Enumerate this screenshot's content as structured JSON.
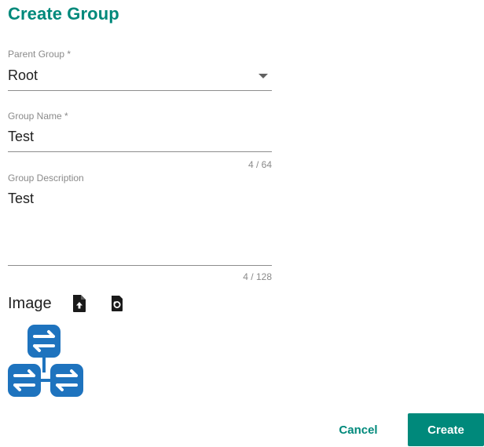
{
  "dialog": {
    "title": "Create Group"
  },
  "parent_group": {
    "label": "Parent Group *",
    "value": "Root"
  },
  "group_name": {
    "label": "Group Name *",
    "value": "Test",
    "counter": "4 / 64"
  },
  "group_description": {
    "label": "Group Description",
    "value": "Test",
    "counter": "4 / 128"
  },
  "image": {
    "label": "Image",
    "upload_icon": "file-upload-icon",
    "reset_icon": "reset-icon",
    "preview_icon": "network-group-icon"
  },
  "actions": {
    "cancel_label": "Cancel",
    "create_label": "Create"
  },
  "colors": {
    "accent": "#00897b",
    "icon_blue": "#1e73be"
  }
}
